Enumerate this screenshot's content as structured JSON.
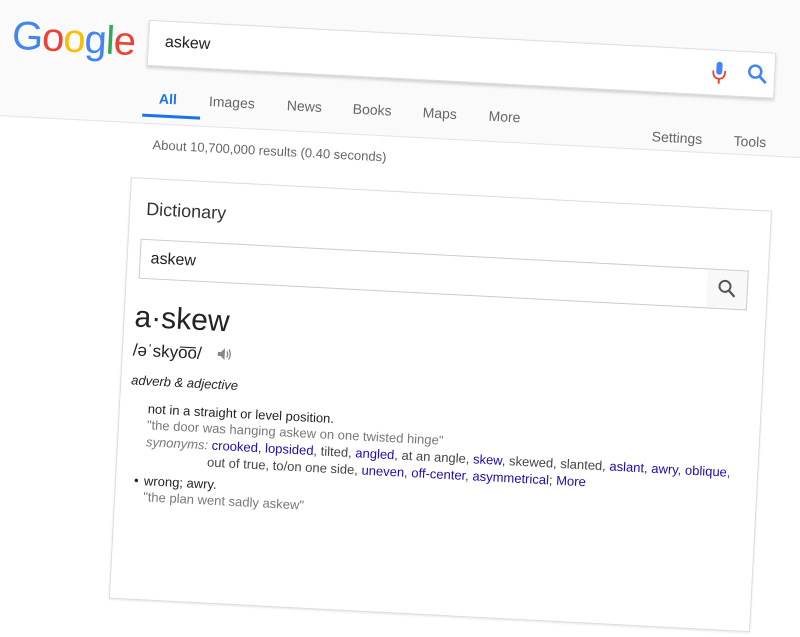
{
  "logo": {
    "letters": [
      {
        "char": "G",
        "color": "#4285F4"
      },
      {
        "char": "o",
        "color": "#EA4335"
      },
      {
        "char": "o",
        "color": "#FBBC05"
      },
      {
        "char": "g",
        "color": "#4285F4"
      },
      {
        "char": "l",
        "color": "#34A853"
      },
      {
        "char": "e",
        "color": "#EA4335"
      }
    ]
  },
  "search": {
    "query": "askew",
    "mic_icon": "microphone-icon",
    "search_icon": "search-icon"
  },
  "tabs": [
    {
      "label": "All",
      "active": true
    },
    {
      "label": "Images"
    },
    {
      "label": "News"
    },
    {
      "label": "Books"
    },
    {
      "label": "Maps"
    },
    {
      "label": "More"
    }
  ],
  "tools": {
    "settings": "Settings",
    "tools": "Tools"
  },
  "results_count": "About 10,700,000 results (0.40 seconds)",
  "dictionary": {
    "title": "Dictionary",
    "input_value": "askew",
    "headword": "a·skew",
    "pronunciation": "/əˈskyo͞o/",
    "part_of_speech": "adverb & adjective",
    "definition1": "not in a straight or level position.",
    "example1": "\"the door was hanging askew on one twisted hinge\"",
    "synonyms_label": "synonyms:",
    "synonyms_line1": [
      {
        "text": "crooked",
        "link": true
      },
      {
        "text": ", ",
        "link": false
      },
      {
        "text": "lopsided",
        "link": true
      },
      {
        "text": ", tilted, ",
        "link": false
      },
      {
        "text": "angled",
        "link": true
      },
      {
        "text": ", at an angle, ",
        "link": false
      },
      {
        "text": "skew",
        "link": true
      },
      {
        "text": ", skewed, slanted, ",
        "link": false
      },
      {
        "text": "aslant",
        "link": true
      },
      {
        "text": ", ",
        "link": false
      },
      {
        "text": "awry",
        "link": true
      },
      {
        "text": ", ",
        "link": false
      },
      {
        "text": "oblique",
        "link": true
      },
      {
        "text": ",",
        "link": false
      }
    ],
    "synonyms_line2": [
      {
        "text": "out of true, to/on one side, ",
        "link": false
      },
      {
        "text": "uneven",
        "link": true
      },
      {
        "text": ", ",
        "link": false
      },
      {
        "text": "off-center",
        "link": true
      },
      {
        "text": ", ",
        "link": false
      },
      {
        "text": "asymmetrical",
        "link": true
      },
      {
        "text": "; ",
        "link": false
      },
      {
        "text": "More",
        "link": true
      }
    ],
    "bullet": "•",
    "definition2": "wrong; awry.",
    "example2": "\"the plan went sadly askew\""
  }
}
